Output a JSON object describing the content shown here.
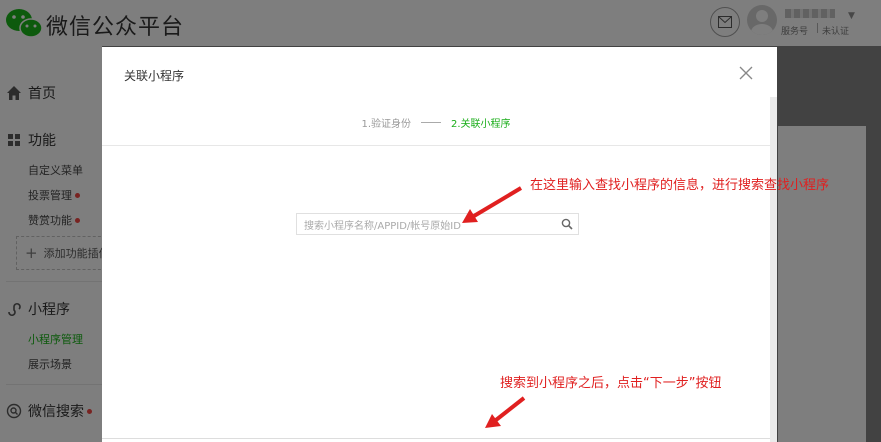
{
  "header": {
    "brand": "微信公众平台",
    "account_type": "服务号",
    "account_status": "未认证",
    "account_arrow": "▼"
  },
  "sidebar": {
    "home": "首页",
    "feature_group": "功能",
    "feature_items": [
      {
        "label": "自定义菜单",
        "badge": false
      },
      {
        "label": "投票管理",
        "badge": true
      },
      {
        "label": "赞赏功能",
        "badge": true
      }
    ],
    "add_plugin": "添加功能插件",
    "mini_group": "小程序",
    "mini_items": [
      {
        "label": "小程序管理",
        "active": true
      },
      {
        "label": "展示场景",
        "active": false
      }
    ],
    "search_group": "微信搜索"
  },
  "dialog": {
    "title": "关联小程序",
    "step1": "1.验证身份",
    "step2": "2.关联小程序",
    "search_placeholder": "搜索小程序名称/APPID/帐号原始ID",
    "search_value": ""
  },
  "annotations": {
    "note1": "在这里输入查找小程序的信息，进行搜索查找小程序",
    "note2": "搜索到小程序之后，点击“下一步”按钮"
  },
  "colors": {
    "accent_green": "#1aad19",
    "badge_red": "#e64340",
    "annotation_red": "#e02020"
  }
}
